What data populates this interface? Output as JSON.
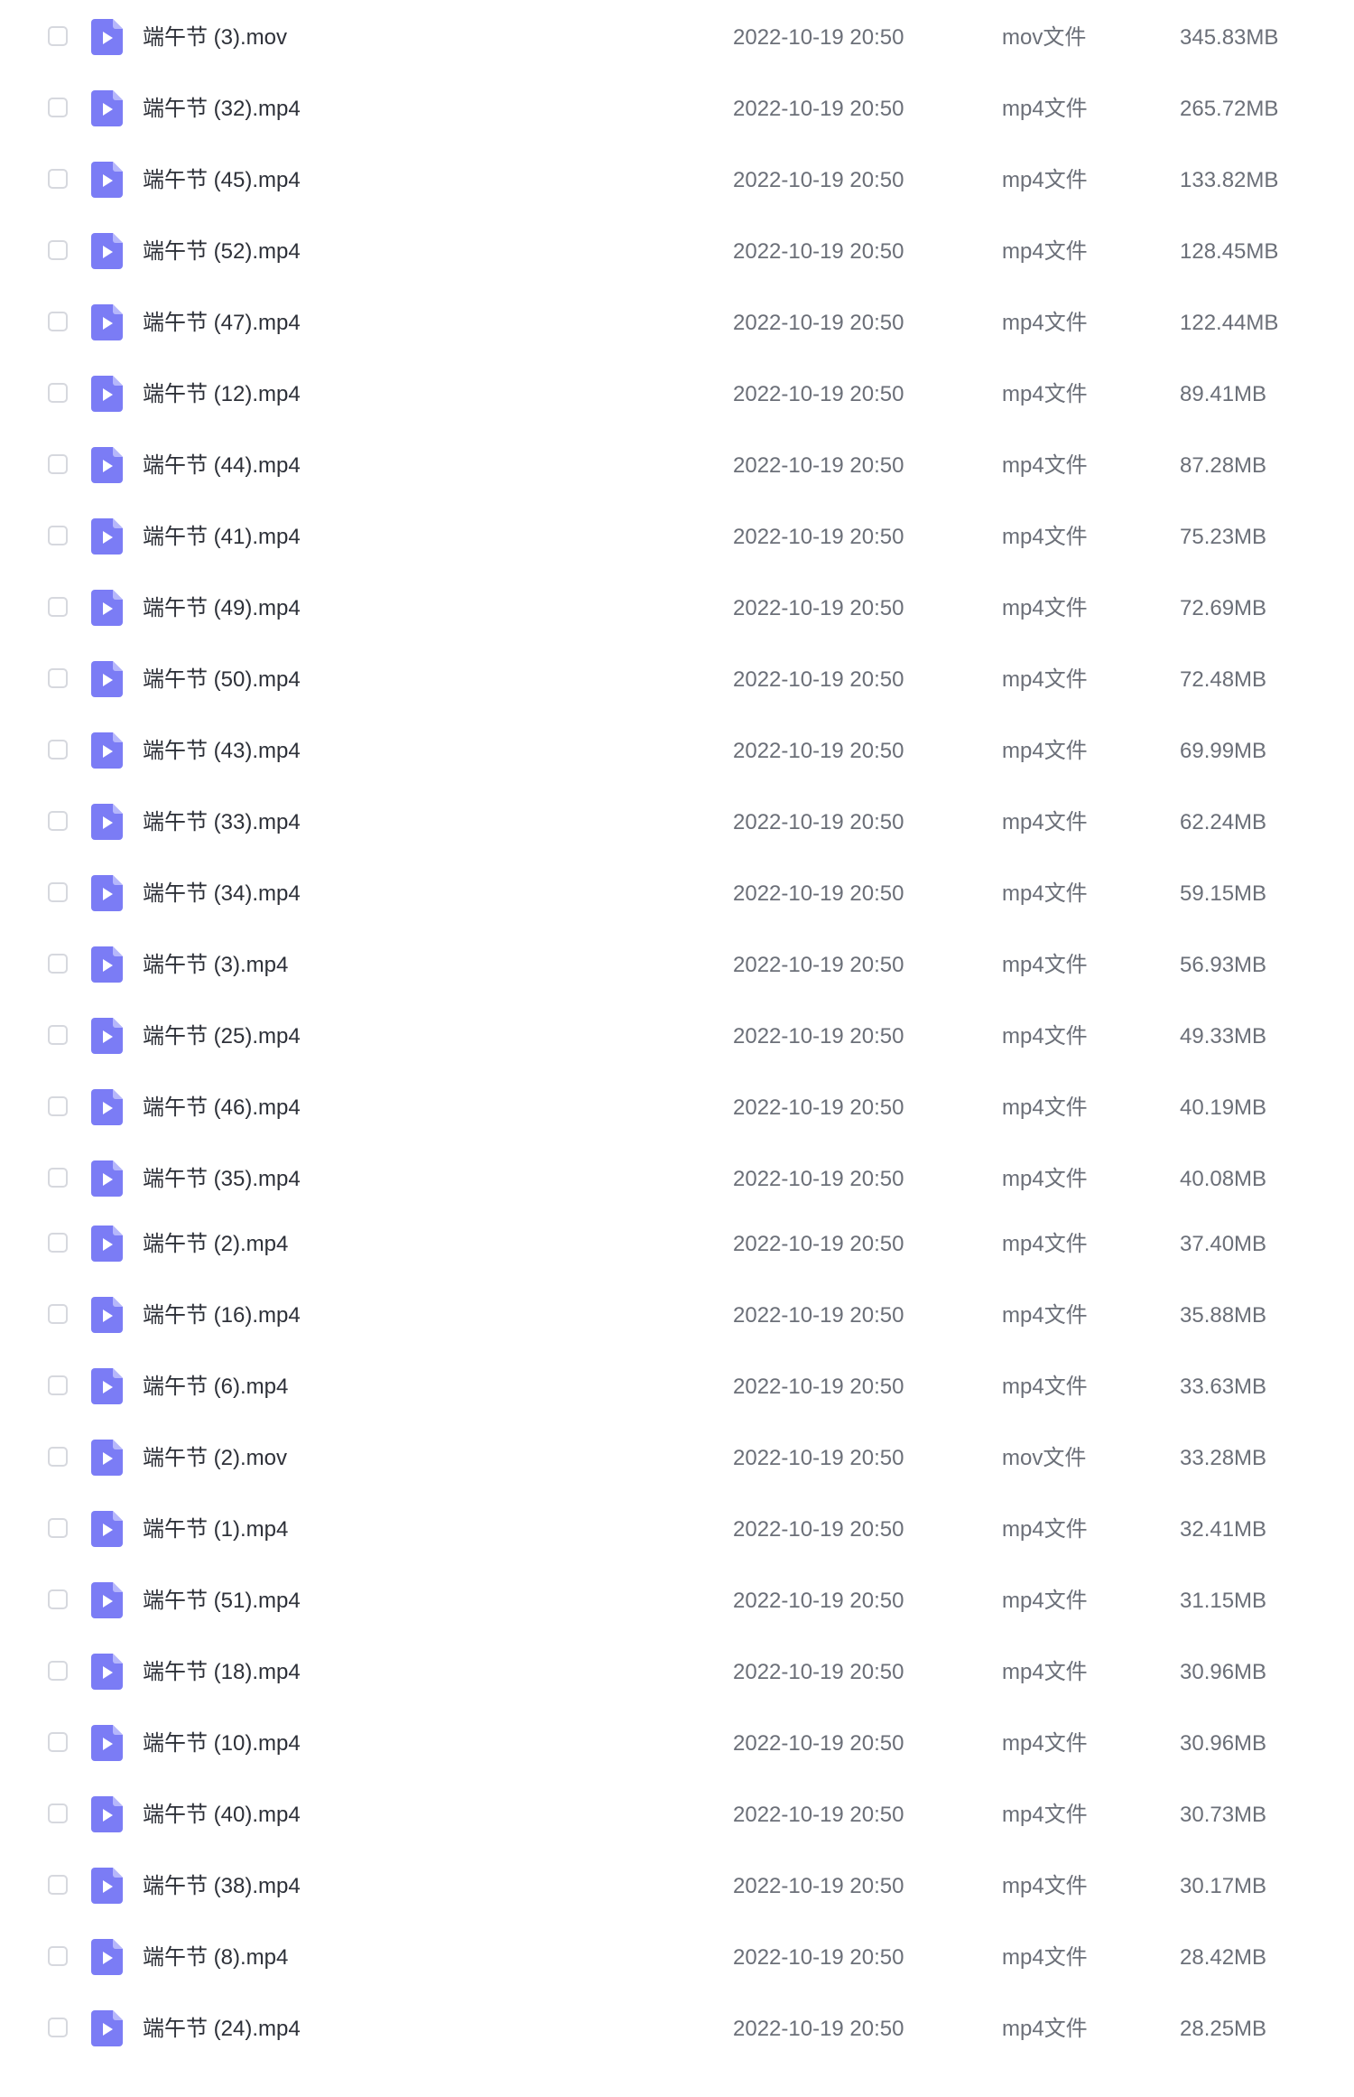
{
  "icon": "video-file-icon",
  "accent_color": "#7b7cf5",
  "files": [
    {
      "name": "端午节 (3).mov",
      "date": "2022-10-19 20:50",
      "type": "mov文件",
      "size": "345.83MB"
    },
    {
      "name": "端午节 (32).mp4",
      "date": "2022-10-19 20:50",
      "type": "mp4文件",
      "size": "265.72MB"
    },
    {
      "name": "端午节 (45).mp4",
      "date": "2022-10-19 20:50",
      "type": "mp4文件",
      "size": "133.82MB"
    },
    {
      "name": "端午节 (52).mp4",
      "date": "2022-10-19 20:50",
      "type": "mp4文件",
      "size": "128.45MB"
    },
    {
      "name": "端午节 (47).mp4",
      "date": "2022-10-19 20:50",
      "type": "mp4文件",
      "size": "122.44MB"
    },
    {
      "name": "端午节 (12).mp4",
      "date": "2022-10-19 20:50",
      "type": "mp4文件",
      "size": "89.41MB"
    },
    {
      "name": "端午节 (44).mp4",
      "date": "2022-10-19 20:50",
      "type": "mp4文件",
      "size": "87.28MB"
    },
    {
      "name": "端午节 (41).mp4",
      "date": "2022-10-19 20:50",
      "type": "mp4文件",
      "size": "75.23MB"
    },
    {
      "name": "端午节 (49).mp4",
      "date": "2022-10-19 20:50",
      "type": "mp4文件",
      "size": "72.69MB"
    },
    {
      "name": "端午节 (50).mp4",
      "date": "2022-10-19 20:50",
      "type": "mp4文件",
      "size": "72.48MB"
    },
    {
      "name": "端午节 (43).mp4",
      "date": "2022-10-19 20:50",
      "type": "mp4文件",
      "size": "69.99MB"
    },
    {
      "name": "端午节 (33).mp4",
      "date": "2022-10-19 20:50",
      "type": "mp4文件",
      "size": "62.24MB"
    },
    {
      "name": "端午节 (34).mp4",
      "date": "2022-10-19 20:50",
      "type": "mp4文件",
      "size": "59.15MB"
    },
    {
      "name": "端午节 (3).mp4",
      "date": "2022-10-19 20:50",
      "type": "mp4文件",
      "size": "56.93MB"
    },
    {
      "name": "端午节 (25).mp4",
      "date": "2022-10-19 20:50",
      "type": "mp4文件",
      "size": "49.33MB"
    },
    {
      "name": "端午节 (46).mp4",
      "date": "2022-10-19 20:50",
      "type": "mp4文件",
      "size": "40.19MB"
    },
    {
      "name": "端午节 (35).mp4",
      "date": "2022-10-19 20:50",
      "type": "mp4文件",
      "size": "40.08MB"
    },
    {
      "name": "端午节 (2).mp4",
      "date": "2022-10-19 20:50",
      "type": "mp4文件",
      "size": "37.40MB"
    },
    {
      "name": "端午节 (16).mp4",
      "date": "2022-10-19 20:50",
      "type": "mp4文件",
      "size": "35.88MB"
    },
    {
      "name": "端午节 (6).mp4",
      "date": "2022-10-19 20:50",
      "type": "mp4文件",
      "size": "33.63MB"
    },
    {
      "name": "端午节 (2).mov",
      "date": "2022-10-19 20:50",
      "type": "mov文件",
      "size": "33.28MB"
    },
    {
      "name": "端午节 (1).mp4",
      "date": "2022-10-19 20:50",
      "type": "mp4文件",
      "size": "32.41MB"
    },
    {
      "name": "端午节 (51).mp4",
      "date": "2022-10-19 20:50",
      "type": "mp4文件",
      "size": "31.15MB"
    },
    {
      "name": "端午节 (18).mp4",
      "date": "2022-10-19 20:50",
      "type": "mp4文件",
      "size": "30.96MB"
    },
    {
      "name": "端午节 (10).mp4",
      "date": "2022-10-19 20:50",
      "type": "mp4文件",
      "size": "30.96MB"
    },
    {
      "name": "端午节 (40).mp4",
      "date": "2022-10-19 20:50",
      "type": "mp4文件",
      "size": "30.73MB"
    },
    {
      "name": "端午节 (38).mp4",
      "date": "2022-10-19 20:50",
      "type": "mp4文件",
      "size": "30.17MB"
    },
    {
      "name": "端午节 (8).mp4",
      "date": "2022-10-19 20:50",
      "type": "mp4文件",
      "size": "28.42MB"
    },
    {
      "name": "端午节 (24).mp4",
      "date": "2022-10-19 20:50",
      "type": "mp4文件",
      "size": "28.25MB"
    }
  ]
}
